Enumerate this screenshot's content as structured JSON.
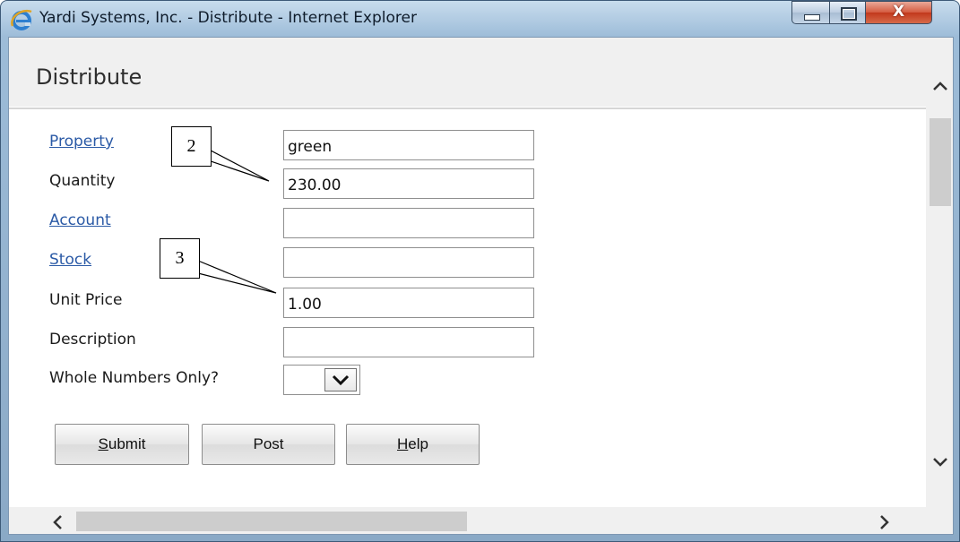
{
  "window": {
    "title": "Yardi Systems, Inc. - Distribute - Internet Explorer",
    "close_label": "X"
  },
  "page": {
    "title": "Distribute"
  },
  "form": {
    "property_label": "Property",
    "property_value": "green",
    "quantity_label": "Quantity",
    "quantity_value": "230.00",
    "account_label": "Account",
    "account_value": "",
    "stock_label": "Stock",
    "stock_value": "",
    "unit_price_label": "Unit Price",
    "unit_price_value": "1.00",
    "description_label": "Description",
    "description_value": "",
    "whole_numbers_label": "Whole Numbers Only?",
    "whole_numbers_value": ""
  },
  "buttons": {
    "submit_first": "S",
    "submit_rest": "ubmit",
    "post": "Post",
    "help_first": "H",
    "help_rest": "elp"
  },
  "callouts": {
    "quantity_marker": "2",
    "unit_price_marker": "3"
  },
  "icons": {
    "browser": "internet-explorer-icon",
    "minimize": "minimize-icon",
    "maximize": "maximize-icon",
    "close": "close-icon",
    "dropdown": "chevron-down-icon",
    "scroll_up": "chevron-up-icon",
    "scroll_down": "chevron-down-icon",
    "scroll_left": "chevron-left-icon",
    "scroll_right": "chevron-right-icon"
  },
  "colors": {
    "link": "#2b5aa6",
    "close_button": "#c2381c",
    "title_bar": "#aac6df"
  }
}
